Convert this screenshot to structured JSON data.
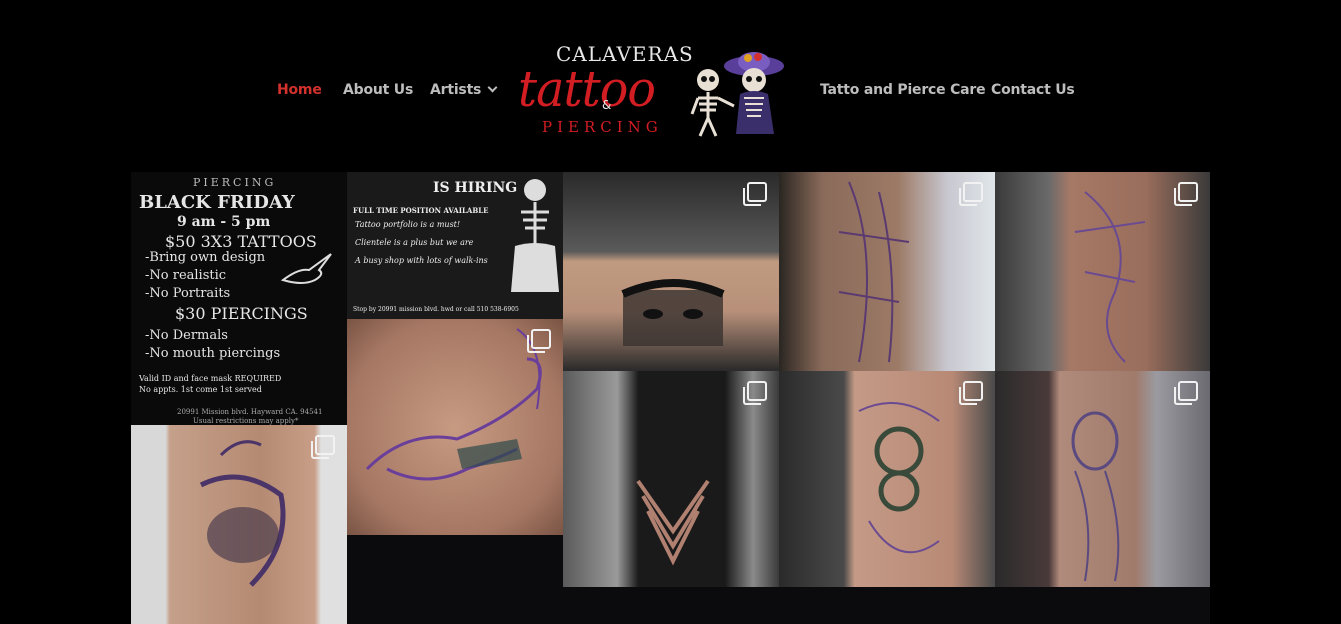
{
  "nav": {
    "items": [
      {
        "label": "Home",
        "active": true
      },
      {
        "label": "About Us"
      },
      {
        "label": "Artists",
        "has_dropdown": true
      },
      {
        "label": "Tatto and Pierce Care"
      },
      {
        "label": "Contact Us"
      }
    ]
  },
  "logo": {
    "top": "CALAVERAS",
    "main": "tattoo",
    "amp": "&",
    "bottom": "PIERCING"
  },
  "feed": {
    "flyer": {
      "header": "PIERCING",
      "title": "BLACK FRIDAY",
      "hours": "9 am - 5 pm",
      "tattoo_deal": "$50 3X3 TATTOOS",
      "t1": "-Bring own design",
      "t2": "-No realistic",
      "t3": "-No Portraits",
      "piercing_deal": "$30 PIERCINGS",
      "p1": "-No Dermals",
      "p2": "-No mouth piercings",
      "n1": "Valid ID and face mask REQUIRED",
      "n2": "No appts. 1st come 1st served",
      "address": "20991 Mission blvd. Hayward CA. 94541",
      "restrictions": "Usual restrictions may apply*"
    },
    "hiring": {
      "title": "IS HIRING",
      "sub": "FULL TIME POSITION AVAILABLE",
      "l1": "Tattoo portfolio is a must!",
      "l2": "Clientele is a plus but we are",
      "l3": "A busy shop with lots of walk-ins",
      "footer": "Stop by 20991 mission blvd. hwd or call 510 538-6905"
    },
    "tattoo_count": 9
  },
  "colors": {
    "background": "#000000",
    "nav_text": "#bdbdbd",
    "nav_active": "#d3312c",
    "logo_red": "#d21d23"
  }
}
